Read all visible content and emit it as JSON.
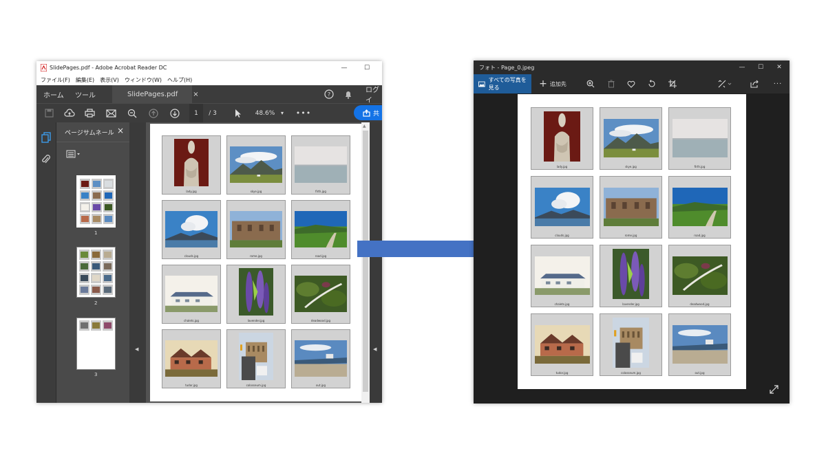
{
  "acrobat": {
    "title": "SlidePages.pdf - Adobe Acrobat Reader DC",
    "menu": [
      "ファイル(F)",
      "編集(E)",
      "表示(V)",
      "ウィンドウ(W)",
      "ヘルプ(H)"
    ],
    "tabs": {
      "home": "ホーム",
      "tools": "ツール",
      "document": "SlidePages.pdf",
      "login": "ログイ"
    },
    "toolbar": {
      "page_current": "1",
      "page_total": "/ 3",
      "zoom": "48.6%",
      "share": "共"
    },
    "panel": {
      "title": "ページサムネール",
      "thumb_labels": [
        "1",
        "2",
        "3"
      ]
    },
    "photos": [
      {
        "name": "lady.jpg",
        "scene": "statue"
      },
      {
        "name": "skye.jpg",
        "scene": "mountain"
      },
      {
        "name": "firth.jpg",
        "scene": "sea"
      },
      {
        "name": "clouds.jpg",
        "scene": "clouds"
      },
      {
        "name": "rome.jpg",
        "scene": "ruins"
      },
      {
        "name": "road.jpg",
        "scene": "road"
      },
      {
        "name": "chalets.jpg",
        "scene": "house"
      },
      {
        "name": "lavender.jpg",
        "scene": "lupin"
      },
      {
        "name": "deadwood.jpg",
        "scene": "moss"
      },
      {
        "name": "tudor.jpg",
        "scene": "tudor"
      },
      {
        "name": "colosseum.jpg",
        "scene": "colosseum"
      },
      {
        "name": "out.jpg",
        "scene": "beach"
      }
    ]
  },
  "photos_app": {
    "title": "フォト - Page_0.jpeg",
    "all_photos": "すべての写真を見る",
    "add_to": "追加先"
  },
  "colors": {
    "arrow": "#4472c4",
    "acrobat_dark": "#3c3c3c",
    "photos_accent": "#1f5c99"
  }
}
